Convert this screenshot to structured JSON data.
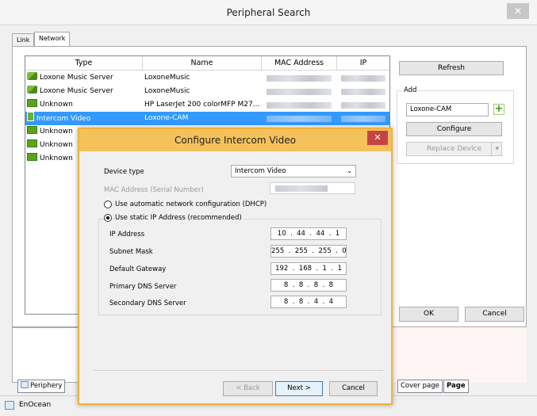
{
  "window": {
    "title": "Peripheral Search",
    "close_glyph": "✕"
  },
  "tabs": [
    {
      "label": "Link"
    },
    {
      "label": "Network"
    }
  ],
  "table": {
    "headers": [
      "Type",
      "Name",
      "MAC Address",
      "IP"
    ],
    "rows": [
      {
        "type": "Loxone Music Server",
        "name": "LoxoneMusic",
        "icon": "music-server-icon"
      },
      {
        "type": "Loxone Music Server",
        "name": "LoxoneMusic",
        "icon": "music-server-icon"
      },
      {
        "type": "Unknown",
        "name": "HP LaserJet 200 colorMFP M27...",
        "icon": "network-device-icon"
      },
      {
        "type": "Intercom Video",
        "name": "Loxone-CAM",
        "icon": "intercom-icon",
        "selected": true
      },
      {
        "type": "Unknown",
        "name": "",
        "icon": "network-device-icon"
      },
      {
        "type": "Unknown",
        "name": "",
        "icon": "network-device-icon"
      },
      {
        "type": "Unknown",
        "name": "",
        "icon": "network-device-icon"
      }
    ]
  },
  "side": {
    "refresh": "Refresh",
    "add_label": "Add",
    "add_value": "Loxone-CAM",
    "configure": "Configure",
    "replace": "Replace Device",
    "replace_arrow": "▾"
  },
  "footer": {
    "ok": "OK",
    "cancel": "Cancel"
  },
  "bottom_tabs": {
    "periphery": "Periphery",
    "cover_page": "Cover page",
    "page": "Page",
    "enocean": "EnOcean"
  },
  "dialog": {
    "title": "Configure Intercom Video",
    "close_glyph": "✕",
    "device_type_label": "Device type",
    "device_type_value": "Intercom Video",
    "select_arrow": "⌄",
    "mac_label": "MAC Address (Serial Number)",
    "dhcp_label": "Use automatic network configuration (DHCP)",
    "static_label": "Use static IP Address (recommended)",
    "fields": [
      {
        "label": "IP Address",
        "value": "10  .  44  .  44  .  1"
      },
      {
        "label": "Subnet Mask",
        "value": "255  .  255  .  255  .  0"
      },
      {
        "label": "Default Gateway",
        "value": "192  .  168  .  1  .  1"
      },
      {
        "label": "Primary DNS Server",
        "value": "8  .  8  .  8  .  8"
      },
      {
        "label": "Secondary DNS Server",
        "value": "8  .  8  .  4  .  4"
      }
    ],
    "back": "< Back",
    "next": "Next >",
    "cancel": "Cancel"
  }
}
